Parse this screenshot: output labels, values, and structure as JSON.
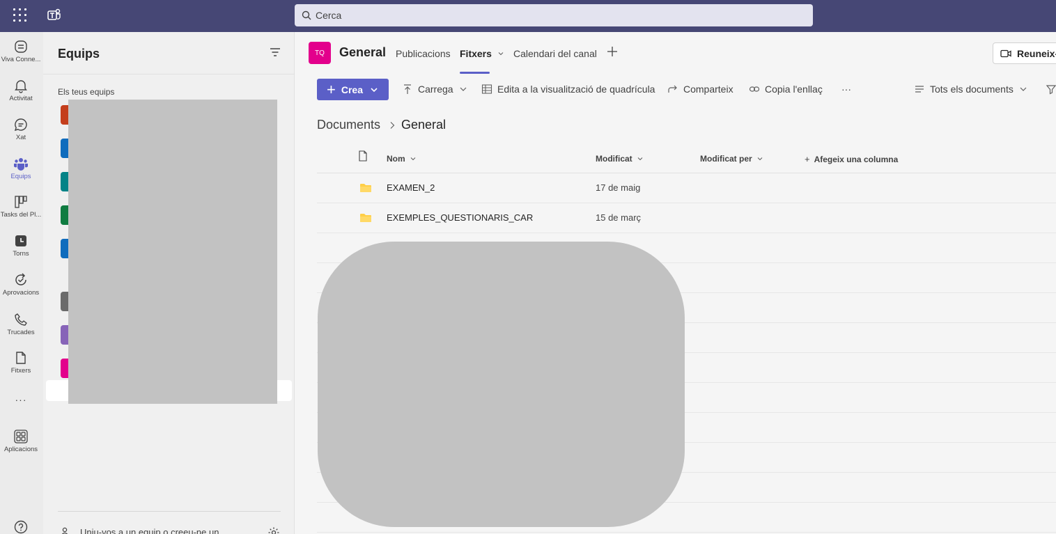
{
  "search": {
    "placeholder": "Cerca"
  },
  "rail": {
    "items": [
      {
        "label": "Viva Conne...",
        "icon": "viva-connections-icon"
      },
      {
        "label": "Activitat",
        "icon": "bell-icon"
      },
      {
        "label": "Xat",
        "icon": "chat-icon"
      },
      {
        "label": "Equips",
        "icon": "teams-icon",
        "active": true
      },
      {
        "label": "Tasks del Pl...",
        "icon": "tasks-icon"
      },
      {
        "label": "Torns",
        "icon": "shifts-icon"
      },
      {
        "label": "Aprovacions",
        "icon": "approvals-icon"
      },
      {
        "label": "Trucades",
        "icon": "phone-icon"
      },
      {
        "label": "Fitxers",
        "icon": "file-icon"
      },
      {
        "label": "",
        "icon": "more-icon"
      },
      {
        "label": "Aplicacions",
        "icon": "apps-icon"
      },
      {
        "label": "",
        "icon": "help-icon"
      }
    ],
    "more": "···"
  },
  "panel": {
    "title": "Equips",
    "section_label": "Els teus equips",
    "join_label": "Uniu-vos a un equip o creeu-ne un",
    "team_colors": [
      "#c43e1c",
      "#0f6cbd",
      "#038387",
      "#107c41",
      "#0f6cbd",
      "#6b6b6b",
      "#8764b8",
      "#e3008c"
    ]
  },
  "channel": {
    "avatar": "TQ",
    "name": "General",
    "tabs": {
      "posts": "Publicacions",
      "files": "Fitxers",
      "calendar": "Calendari del canal"
    },
    "meet_label": "Reuneix-"
  },
  "commands": {
    "create": "Crea",
    "upload": "Carrega",
    "grid_edit": "Edita a la visualització de quadrícula",
    "share": "Comparteix",
    "copy_link": "Copia l'enllaç",
    "more": "···",
    "view": "Tots els documents"
  },
  "breadcrumb": {
    "root": "Documents",
    "current": "General"
  },
  "table": {
    "columns": {
      "name": "Nom",
      "modified": "Modificat",
      "modified_by": "Modificat per",
      "add_column": "Afegeix una columna"
    },
    "rows": [
      {
        "name": "EXAMEN_2",
        "modified": "17 de maig"
      },
      {
        "name": "EXEMPLES_QUESTIONARIS_CAR",
        "modified": "15 de març"
      }
    ]
  },
  "colors": {
    "topbar": "#464775",
    "accent": "#5b5fc7",
    "channel": "#e3008c"
  }
}
